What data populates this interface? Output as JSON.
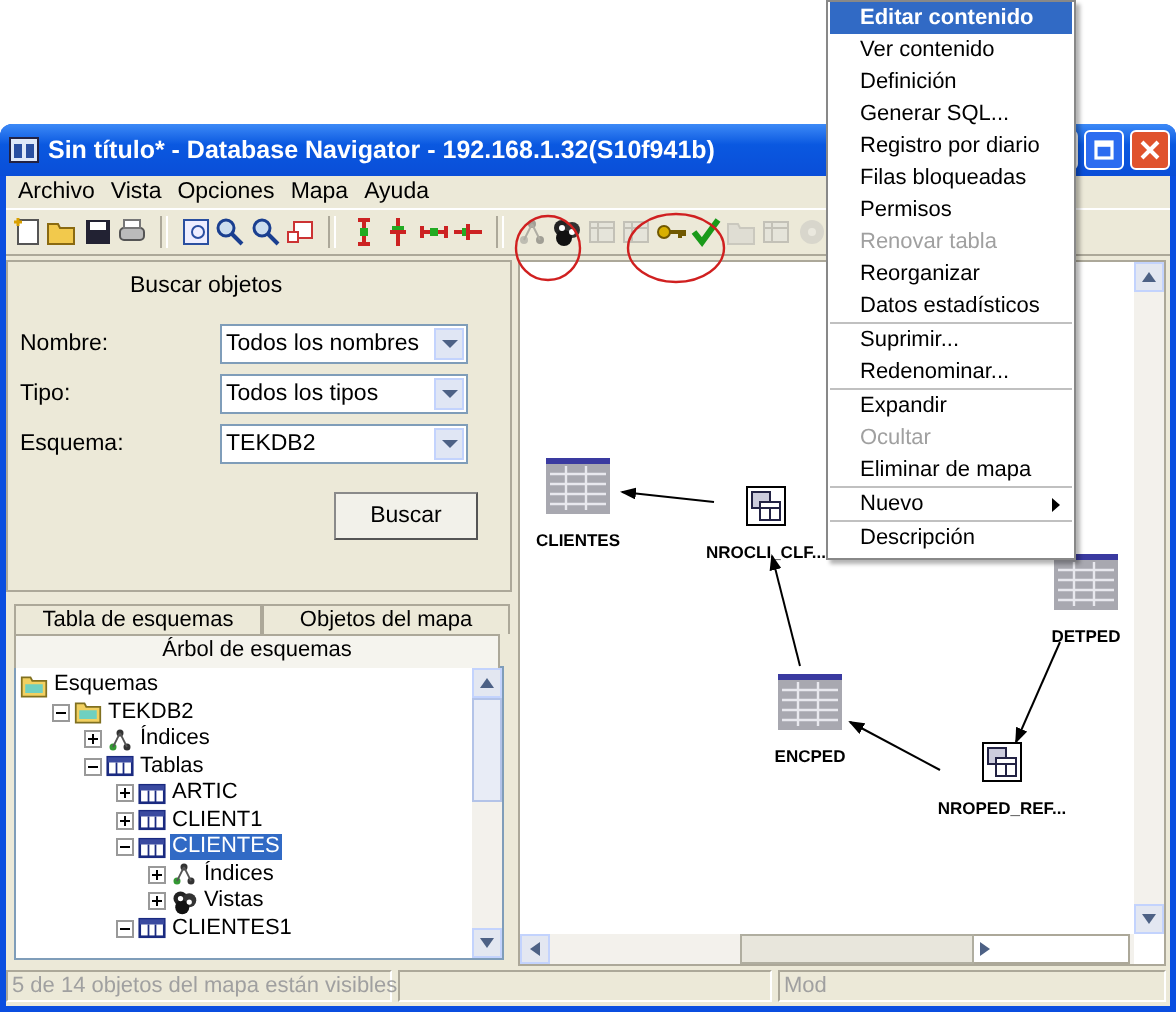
{
  "window": {
    "title": "Sin título* - Database Navigator - 192.168.1.32(S10f941b)"
  },
  "menu_bar": [
    "Archivo",
    "Vista",
    "Opciones",
    "Mapa",
    "Ayuda"
  ],
  "toolbar": [
    [
      {
        "kind": "new",
        "disabled": false
      },
      {
        "kind": "open",
        "disabled": false
      },
      {
        "kind": "save",
        "disabled": false
      },
      {
        "kind": "print",
        "disabled": false
      }
    ],
    [
      {
        "kind": "map",
        "disabled": false
      },
      {
        "kind": "zoom_in",
        "disabled": false
      },
      {
        "kind": "zoom_out",
        "disabled": false
      },
      {
        "kind": "select",
        "disabled": false
      }
    ],
    [
      {
        "kind": "v_expand",
        "disabled": false
      },
      {
        "kind": "v_shrink",
        "disabled": false
      },
      {
        "kind": "h_expand",
        "disabled": false
      },
      {
        "kind": "h_shrink",
        "disabled": false
      }
    ],
    [
      {
        "kind": "index",
        "disabled": true
      },
      {
        "kind": "views",
        "disabled": false
      },
      {
        "kind": "table",
        "disabled": true
      },
      {
        "kind": "table",
        "disabled": true
      },
      {
        "kind": "key",
        "disabled": false
      },
      {
        "kind": "check",
        "disabled": false
      },
      {
        "kind": "folder",
        "disabled": true
      },
      {
        "kind": "table",
        "disabled": true
      },
      {
        "kind": "gear",
        "disabled": true
      }
    ]
  ],
  "search": {
    "title": "Buscar objetos",
    "fields": [
      {
        "label": "Nombre:",
        "value": "Todos los nombres"
      },
      {
        "label": "Tipo:",
        "value": "Todos los tipos"
      },
      {
        "label": "Esquema:",
        "value": "TEKDB2"
      }
    ],
    "button": "Buscar"
  },
  "tabs": [
    {
      "label": "Tabla de esquemas",
      "selected": false
    },
    {
      "label": "Objetos del mapa",
      "selected": false
    },
    {
      "label": "Árbol de esquemas",
      "selected": true
    }
  ],
  "tree": [
    {
      "label": "Esquemas",
      "kind": "folder",
      "selected": false,
      "expanded": true,
      "children": [
        {
          "label": "TEKDB2",
          "kind": "folder",
          "selected": false,
          "expanded": true,
          "children": [
            {
              "label": "Índices",
              "kind": "index",
              "selected": false,
              "expanded": false
            },
            {
              "label": "Tablas",
              "kind": "table",
              "selected": false,
              "expanded": true,
              "children": [
                {
                  "label": "ARTIC",
                  "kind": "table",
                  "selected": false,
                  "expanded": false
                },
                {
                  "label": "CLIENT1",
                  "kind": "table",
                  "selected": false,
                  "expanded": false
                },
                {
                  "label": "CLIENTES",
                  "kind": "table",
                  "selected": true,
                  "expanded": true,
                  "children": [
                    {
                      "label": "Índices",
                      "kind": "index",
                      "selected": false,
                      "expanded": false
                    },
                    {
                      "label": "Vistas",
                      "kind": "views",
                      "selected": false,
                      "expanded": false
                    }
                  ]
                },
                {
                  "label": "CLIENTES1",
                  "kind": "table",
                  "selected": false,
                  "expanded": true
                }
              ]
            }
          ]
        }
      ]
    }
  ],
  "map_nodes": [
    {
      "label": "CLIENTES",
      "kind": "table"
    },
    {
      "label": "NROCLI_CLF...",
      "kind": "index"
    },
    {
      "label": "DETPED",
      "kind": "table"
    },
    {
      "label": "ENCPED",
      "kind": "table"
    },
    {
      "label": "NROPED_REF...",
      "kind": "index"
    }
  ],
  "status_bar": {
    "message": "5 de 14 objetos del mapa están visibles",
    "mode": "Mod"
  },
  "context_menu": [
    {
      "kind": "item",
      "label": "Editar contenido",
      "selected": true,
      "disabled": false
    },
    {
      "kind": "item",
      "label": "Ver contenido",
      "selected": false,
      "disabled": false
    },
    {
      "kind": "item",
      "label": "Definición",
      "selected": false,
      "disabled": false
    },
    {
      "kind": "item",
      "label": "Generar SQL...",
      "selected": false,
      "disabled": false
    },
    {
      "kind": "item",
      "label": "Registro por diario",
      "selected": false,
      "disabled": false
    },
    {
      "kind": "item",
      "label": "Filas bloqueadas",
      "selected": false,
      "disabled": false
    },
    {
      "kind": "item",
      "label": "Permisos",
      "selected": false,
      "disabled": false
    },
    {
      "kind": "item",
      "label": "Renovar tabla",
      "selected": false,
      "disabled": true
    },
    {
      "kind": "item",
      "label": "Reorganizar",
      "selected": false,
      "disabled": false
    },
    {
      "kind": "item",
      "label": "Datos estadísticos",
      "selected": false,
      "disabled": false
    },
    {
      "kind": "separator"
    },
    {
      "kind": "item",
      "label": "Suprimir...",
      "selected": false,
      "disabled": false
    },
    {
      "kind": "item",
      "label": "Redenominar...",
      "selected": false,
      "disabled": false
    },
    {
      "kind": "separator"
    },
    {
      "kind": "item",
      "label": "Expandir",
      "selected": false,
      "disabled": false
    },
    {
      "kind": "item",
      "label": "Ocultar",
      "selected": false,
      "disabled": true
    },
    {
      "kind": "item",
      "label": "Eliminar de mapa",
      "selected": false,
      "disabled": false
    },
    {
      "kind": "separator"
    },
    {
      "kind": "submenu",
      "label": "Nuevo",
      "selected": false,
      "disabled": false
    },
    {
      "kind": "separator"
    },
    {
      "kind": "item",
      "label": "Descripción",
      "selected": false,
      "disabled": false
    }
  ]
}
